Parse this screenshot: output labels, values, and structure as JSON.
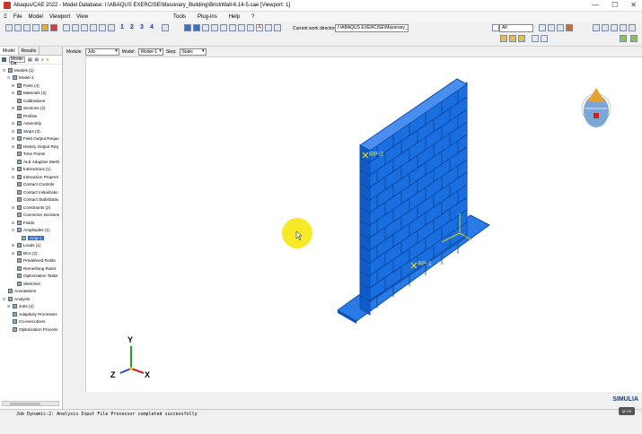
{
  "window": {
    "title": "Abaqus/CAE 2022 - Model Database: I:\\ABAQUS EXERCISE\\Masonary_Building\\BrickWall-6.14-5.cae [Viewport: 1]",
    "controls": [
      "—",
      "☐",
      "✕"
    ]
  },
  "menu": {
    "left": [
      "File",
      "Model",
      "Viewport",
      "View"
    ],
    "right": [
      "Tools",
      "Plug-ins",
      "Help",
      "?"
    ]
  },
  "toolbar": {
    "numbers": [
      "1",
      "2",
      "3",
      "4"
    ],
    "workdir_label": "Current work directory:",
    "workdir_value": "I:\\ABAQUS EXERCISE\\Masonary_Building",
    "selection_filter": "All"
  },
  "context": {
    "module_label": "Module:",
    "module_value": "Job",
    "model_label": "Model:",
    "model_value": "Model-1",
    "step_label": "Step:",
    "step_value": "Static"
  },
  "panel": {
    "tabs": [
      "Model",
      "Results"
    ],
    "tree_toolbar_label": "Model Da"
  },
  "tree": [
    {
      "label": "Models (1)",
      "level": 0,
      "exp": "⊟"
    },
    {
      "label": "Model-1",
      "level": 1,
      "exp": "⊟"
    },
    {
      "label": "Parts (4)",
      "level": 2,
      "exp": "⊞"
    },
    {
      "label": "Materials (2)",
      "level": 2,
      "exp": "⊞"
    },
    {
      "label": "Calibrations",
      "level": 2,
      "exp": ""
    },
    {
      "label": "Sections (2)",
      "level": 2,
      "exp": "⊞"
    },
    {
      "label": "Profiles",
      "level": 2,
      "exp": ""
    },
    {
      "label": "Assembly",
      "level": 2,
      "exp": "⊞"
    },
    {
      "label": "Steps (3)",
      "level": 2,
      "exp": "⊞"
    },
    {
      "label": "Field Output Reque",
      "level": 2,
      "exp": "⊞"
    },
    {
      "label": "History Output Req",
      "level": 2,
      "exp": "⊞"
    },
    {
      "label": "Time Points",
      "level": 2,
      "exp": ""
    },
    {
      "label": "ALE Adaptive Mesh",
      "level": 2,
      "exp": ""
    },
    {
      "label": "Interactions (1)",
      "level": 2,
      "exp": "⊞"
    },
    {
      "label": "Interaction Properti",
      "level": 2,
      "exp": "⊞"
    },
    {
      "label": "Contact Controls",
      "level": 2,
      "exp": ""
    },
    {
      "label": "Contact Initializatio",
      "level": 2,
      "exp": ""
    },
    {
      "label": "Contact Stabilizatio",
      "level": 2,
      "exp": ""
    },
    {
      "label": "Constraints (2)",
      "level": 2,
      "exp": "⊞"
    },
    {
      "label": "Connector Sections",
      "level": 2,
      "exp": ""
    },
    {
      "label": "Fields",
      "level": 2,
      "exp": "⊞"
    },
    {
      "label": "Amplitudes (1)",
      "level": 2,
      "exp": "⊟"
    },
    {
      "label": "Amp-1",
      "level": 3,
      "exp": "",
      "selected": true
    },
    {
      "label": "Loads (1)",
      "level": 2,
      "exp": "⊞"
    },
    {
      "label": "BCs (2)",
      "level": 2,
      "exp": "⊞"
    },
    {
      "label": "Predefined Fields",
      "level": 2,
      "exp": ""
    },
    {
      "label": "Remeshing Rules",
      "level": 2,
      "exp": ""
    },
    {
      "label": "Optimization Tasks",
      "level": 2,
      "exp": ""
    },
    {
      "label": "Sketches",
      "level": 2,
      "exp": ""
    },
    {
      "label": "Annotations",
      "level": 0,
      "exp": ""
    },
    {
      "label": "Analysis",
      "level": 0,
      "exp": "⊟"
    },
    {
      "label": "Jobs (2)",
      "level": 1,
      "exp": "⊞"
    },
    {
      "label": "Adaptivity Processes",
      "level": 1,
      "exp": ""
    },
    {
      "label": "Co-executions",
      "level": 1,
      "exp": ""
    },
    {
      "label": "Optimization Process",
      "level": 1,
      "exp": ""
    }
  ],
  "viewport": {
    "rp_top": "RP-2",
    "rp_bottom": "RP-1",
    "triad": {
      "y": "Y",
      "z": "Z",
      "x": "X"
    },
    "colors": {
      "part": "#1a6fe0",
      "part_dark": "#0d4fb0",
      "part_light": "#4a8ff0",
      "cursor": "#f5e600"
    }
  },
  "status": {
    "message": "Job Dynamic-2: Analysis Input File Processor completed successfully",
    "brand": "SIMULIA",
    "badge": "@ SS"
  }
}
